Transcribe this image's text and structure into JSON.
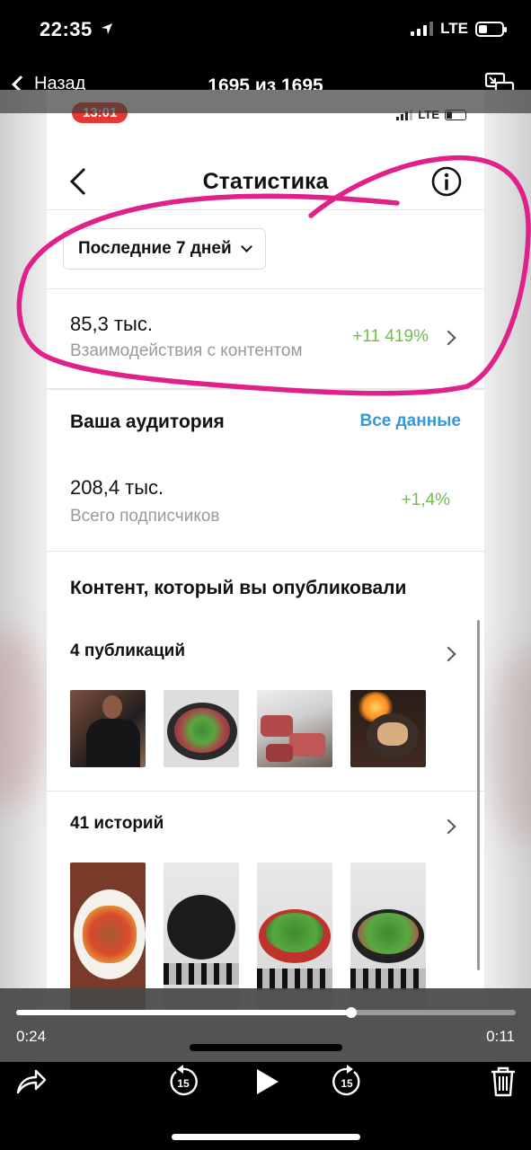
{
  "status_bar": {
    "time": "22:35",
    "network": "LTE"
  },
  "viewer": {
    "back_label": "Назад",
    "title": "1695 из 1695"
  },
  "recording": {
    "status_time": "13:01",
    "network": "LTE"
  },
  "stats": {
    "title": "Статистика",
    "period": "Последние 7 дней",
    "interactions": {
      "value": "85,3 тыс.",
      "label": "Взаимодействия с контентом",
      "change": "+11 419%"
    },
    "audience": {
      "title": "Ваша аудитория",
      "link": "Все данные",
      "value": "208,4 тыс.",
      "label": "Всего подписчиков",
      "change": "+1,4%"
    },
    "content": {
      "title": "Контент, который вы опубликовали",
      "posts_label": "4 публикаций",
      "posts_thumbs": [
        "photo-man-in-cafe",
        "photo-herbs-on-meat-pan",
        "photo-raw-steaks",
        "photo-flame-grill-pan"
      ],
      "stories_label": "41 историй",
      "stories_thumbs": [
        "photo-plated-meal",
        "photo-black-cooking-pot",
        "photo-herbs-in-red-pan",
        "photo-herbs-in-pan-stove"
      ]
    }
  },
  "player": {
    "elapsed": "0:24",
    "remaining": "0:11",
    "progress": 0.67
  },
  "colors": {
    "positive": "#6cc04a",
    "link": "#3897d6",
    "annotation": "#e0218a",
    "recording_pill": "#e53935"
  }
}
